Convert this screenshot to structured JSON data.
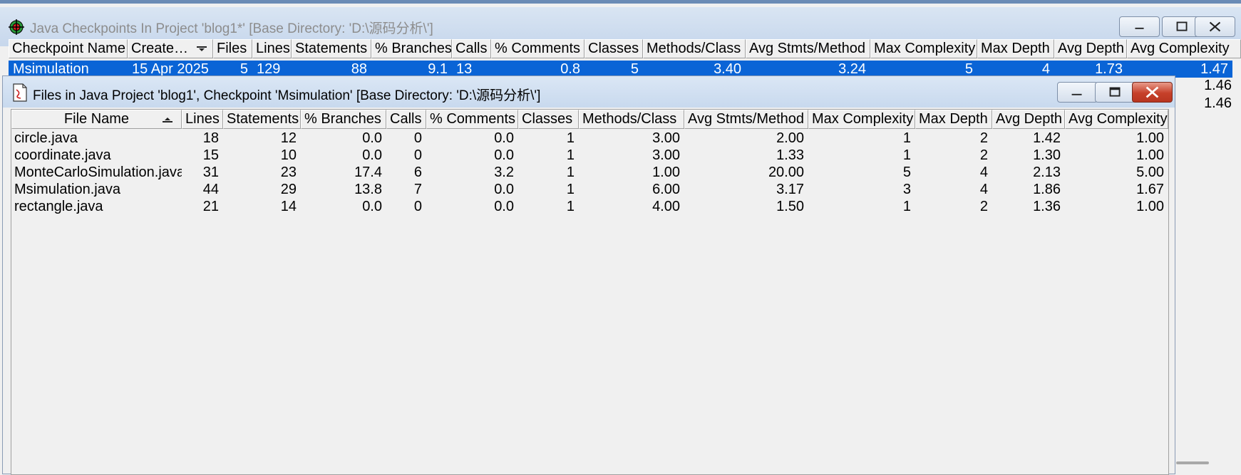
{
  "checkpoints_window": {
    "title": "Java Checkpoints In Project 'blog1*'  [Base Directory: 'D:\\源码分析\\']",
    "columns": [
      "Checkpoint Name",
      "Create…",
      "Files",
      "Lines",
      "Statements",
      "% Branches",
      "Calls",
      "% Comments",
      "Classes",
      "Methods/Class",
      "Avg Stmts/Method",
      "Max Complexity",
      "Max Depth",
      "Avg Depth",
      "Avg Complexity"
    ],
    "sorted_column_icon": "sort-descending-icon",
    "rows": [
      [
        "Msimulation",
        "15 Apr 2025",
        "5",
        "129",
        "88",
        "9.1",
        "13",
        "0.8",
        "5",
        "3.40",
        "3.24",
        "5",
        "4",
        "1.73",
        "1.47"
      ]
    ],
    "hidden_row_values": [
      "1.46",
      "1.46"
    ]
  },
  "files_window": {
    "title": "Files in Java Project 'blog1', Checkpoint 'Msimulation'  [Base Directory: 'D:\\源码分析\\']",
    "columns": [
      "File Name",
      "Lines",
      "Statements",
      "% Branches",
      "Calls",
      "% Comments",
      "Classes",
      "Methods/Class",
      "Avg Stmts/Method",
      "Max Complexity",
      "Max Depth",
      "Avg Depth",
      "Avg Complexity"
    ],
    "sorted_column_icon": "sort-ascending-icon",
    "rows": [
      [
        "circle.java",
        "18",
        "12",
        "0.0",
        "0",
        "0.0",
        "1",
        "3.00",
        "2.00",
        "1",
        "2",
        "1.42",
        "1.00"
      ],
      [
        "coordinate.java",
        "15",
        "10",
        "0.0",
        "0",
        "0.0",
        "1",
        "3.00",
        "1.33",
        "1",
        "2",
        "1.30",
        "1.00"
      ],
      [
        "MonteCarloSimulation.java",
        "31",
        "23",
        "17.4",
        "6",
        "3.2",
        "1",
        "1.00",
        "20.00",
        "5",
        "4",
        "2.13",
        "5.00"
      ],
      [
        "Msimulation.java",
        "44",
        "29",
        "13.8",
        "7",
        "0.0",
        "1",
        "6.00",
        "3.17",
        "3",
        "4",
        "1.86",
        "1.67"
      ],
      [
        "rectangle.java",
        "21",
        "14",
        "0.0",
        "0",
        "0.0",
        "1",
        "4.00",
        "1.50",
        "1",
        "2",
        "1.36",
        "1.00"
      ]
    ]
  },
  "colors": {
    "selection": "#0a64d6",
    "close_button": "#c6402a"
  }
}
